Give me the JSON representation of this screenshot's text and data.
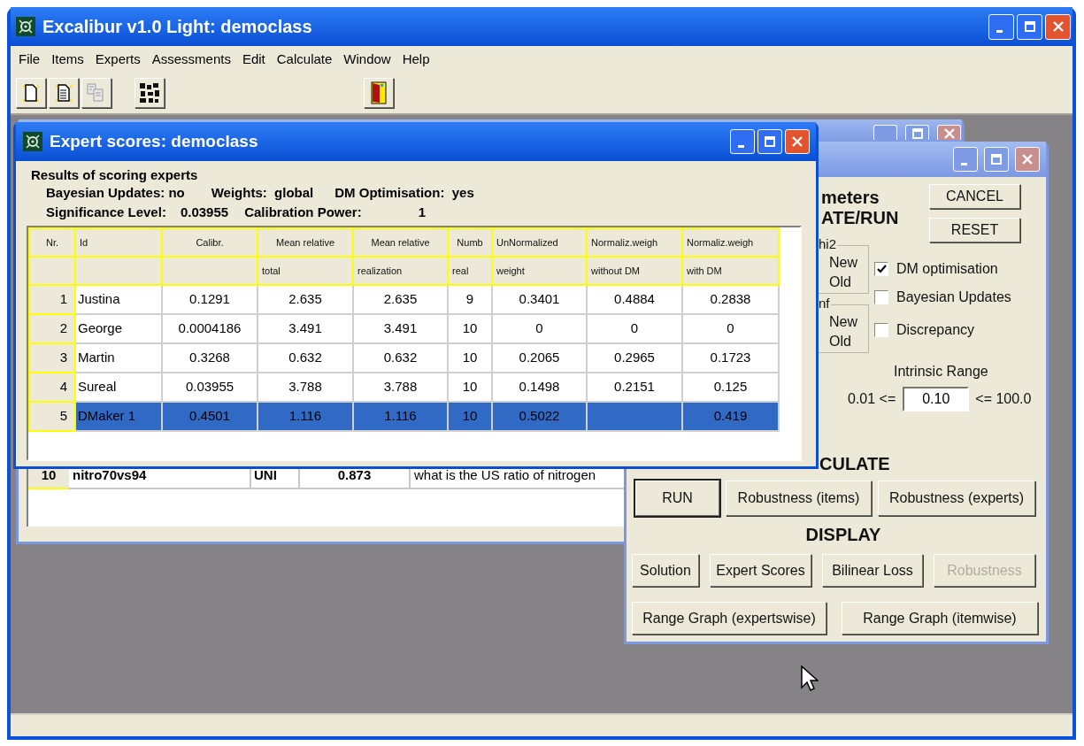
{
  "main_window": {
    "title": "Excalibur v1.0 Light: democlass"
  },
  "menu": [
    "File",
    "Items",
    "Experts",
    "Assessments",
    "Edit",
    "Calculate",
    "Window",
    "Help"
  ],
  "toolbar": [
    {
      "kind": "new"
    },
    {
      "kind": "page"
    },
    {
      "kind": "copy"
    },
    {
      "kind": "experts"
    },
    {
      "kind": "exit"
    }
  ],
  "items_window": {
    "rows": [
      {
        "cells": [
          "10",
          "nitro70vs94",
          "UNI",
          "0.873",
          "what is the US ratio of nitrogen"
        ]
      }
    ]
  },
  "params_window": {
    "heading_fragments": [
      "meters",
      "ATE/RUN"
    ],
    "buttons": [
      "CANCEL",
      "RESET"
    ],
    "groups": [
      {
        "legend": "hi2",
        "options": [
          "New",
          "Old"
        ]
      },
      {
        "legend": "nf",
        "options": [
          "New",
          "Old"
        ]
      }
    ],
    "checkboxes": [
      {
        "label": "DM optimisation",
        "checked": true
      },
      {
        "label": "Bayesian Updates",
        "checked": false
      },
      {
        "label": "Discrepancy",
        "checked": false
      }
    ],
    "intrinsic_range": {
      "label": "Intrinsic Range",
      "min_text": "0.01 <=",
      "value": "0.10",
      "max_text": "<= 100.0"
    },
    "calculate": {
      "heading": "CULATE",
      "buttons": [
        {
          "label": "RUN",
          "focused": true
        },
        {
          "label": "Robustness (items)",
          "focused": false
        },
        {
          "label": "Robustness (experts)",
          "focused": false
        }
      ]
    },
    "display": {
      "heading": "DISPLAY",
      "buttons": [
        {
          "label": "Solution",
          "disabled": false
        },
        {
          "label": "Expert Scores",
          "disabled": false
        },
        {
          "label": "Bilinear Loss",
          "disabled": false
        },
        {
          "label": "Robustness",
          "disabled": true
        },
        {
          "label": "Range Graph (expertswise)",
          "disabled": false
        },
        {
          "label": "Range Graph (itemwise)",
          "disabled": false
        }
      ]
    }
  },
  "expert_window": {
    "title": "Expert scores: democlass",
    "heading": "Results of scoring experts",
    "summary": [
      [
        "Bayesian Updates: no",
        "Weights:  global",
        "DM Optimisation:  yes"
      ],
      [
        "Significance Level:",
        "0.03955",
        "Calibration Power:",
        "1"
      ]
    ],
    "table": {
      "columns": [
        {
          "label": "Nr."
        },
        {
          "label": "Id"
        },
        {
          "label": "Calibr."
        },
        {
          "label": "Mean relative",
          "sublabel": "total"
        },
        {
          "label": "Mean relative",
          "sublabel": "realization"
        },
        {
          "label": "Numb",
          "sublabel": "real"
        },
        {
          "label": "UnNormalized",
          "sublabel": "weight"
        },
        {
          "label": "Normaliz.weigh",
          "sublabel": "without DM"
        },
        {
          "label": "Normaliz.weigh",
          "sublabel": "with DM"
        }
      ],
      "rows": [
        {
          "selected": false,
          "cells": [
            "1",
            "Justina",
            "0.1291",
            "2.635",
            "2.635",
            "9",
            "0.3401",
            "0.4884",
            "0.2838"
          ]
        },
        {
          "selected": false,
          "cells": [
            "2",
            "George",
            "0.0004186",
            "3.491",
            "3.491",
            "10",
            "0",
            "0",
            "0"
          ]
        },
        {
          "selected": false,
          "cells": [
            "3",
            "Martin",
            "0.3268",
            "0.632",
            "0.632",
            "10",
            "0.2065",
            "0.2965",
            "0.1723"
          ]
        },
        {
          "selected": false,
          "cells": [
            "4",
            "Sureal",
            "0.03955",
            "3.788",
            "3.788",
            "10",
            "0.1498",
            "0.2151",
            "0.125"
          ]
        },
        {
          "selected": true,
          "cells": [
            "5",
            "DMaker 1",
            "0.4501",
            "1.116",
            "1.116",
            "10",
            "0.5022",
            null,
            "0.419"
          ]
        }
      ]
    }
  }
}
